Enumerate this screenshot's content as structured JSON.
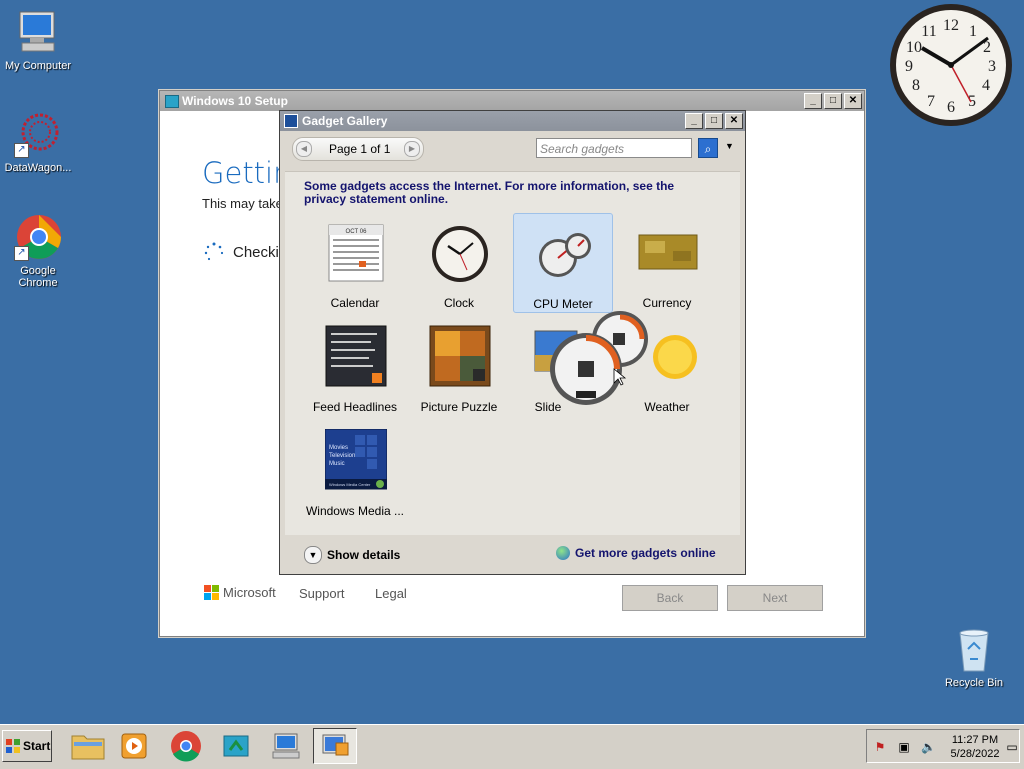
{
  "desktop": {
    "icons": [
      {
        "label": "My Computer"
      },
      {
        "label": "DataWagon..."
      },
      {
        "label": "Google Chrome"
      },
      {
        "label": "Recycle Bin"
      }
    ]
  },
  "setup_window": {
    "title": "Windows 10 Setup",
    "heading": "Gettin",
    "subtext": "This may take",
    "checking": "Checkin",
    "footer": {
      "brand": "Microsoft",
      "support": "Support",
      "legal": "Legal",
      "back": "Back",
      "next": "Next"
    }
  },
  "gadget_gallery": {
    "title": "Gadget Gallery",
    "page_label": "Page 1 of 1",
    "search_placeholder": "Search gadgets",
    "notice": "Some gadgets access the Internet.  For more information, see the privacy statement online.",
    "gadgets": [
      {
        "name": "Calendar"
      },
      {
        "name": "Clock"
      },
      {
        "name": "CPU Meter",
        "selected": true
      },
      {
        "name": "Currency"
      },
      {
        "name": "Feed Headlines"
      },
      {
        "name": "Picture Puzzle"
      },
      {
        "name": "Slide"
      },
      {
        "name": "Weather"
      },
      {
        "name": "Windows Media ..."
      }
    ],
    "show_details": "Show details",
    "get_more": "Get more gadgets online",
    "calendar_month": "OCT 06",
    "media_lines": [
      "Movies",
      "Television",
      "Music"
    ],
    "media_banner": "Windows Media Center"
  },
  "taskbar": {
    "start_label": "Start",
    "time": "11:27 PM",
    "date": "5/28/2022"
  },
  "colors": {
    "desktop": "#3a6ea5",
    "link_blue": "#1a6bbf",
    "notice_navy": "#14146e"
  }
}
